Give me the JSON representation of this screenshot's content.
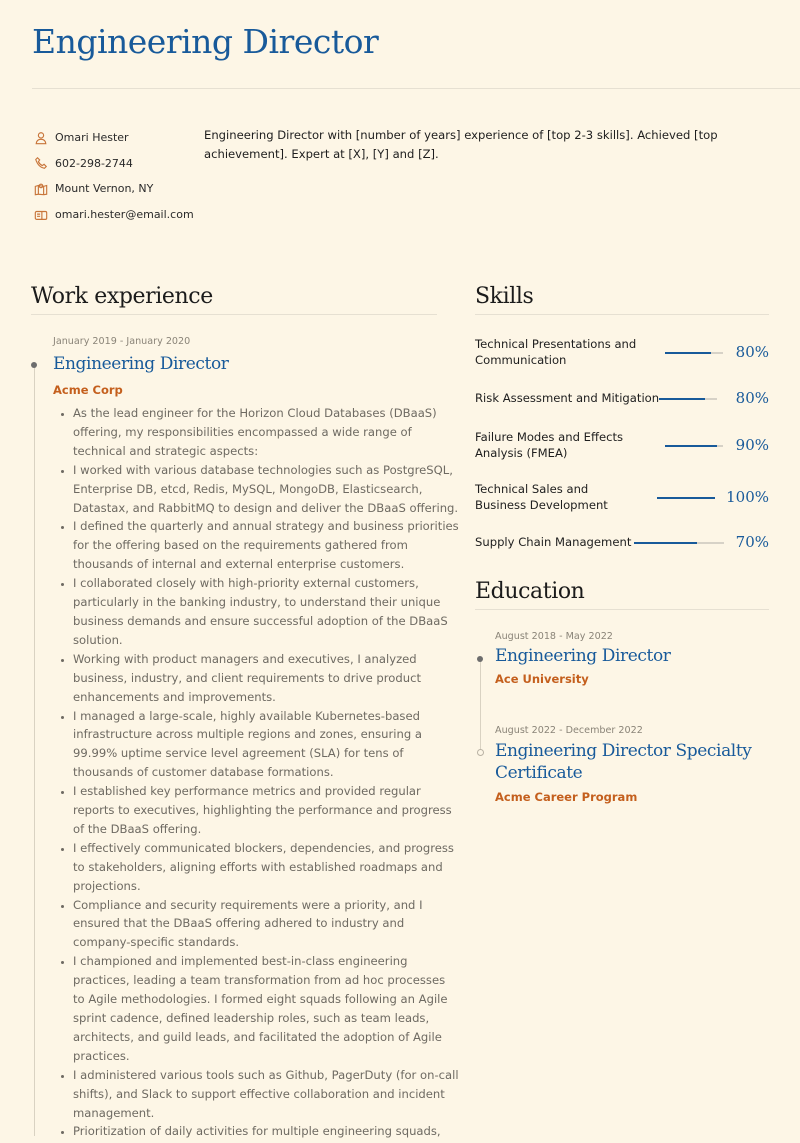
{
  "header": {
    "title": "Engineering Director"
  },
  "contact": {
    "items": [
      {
        "icon": "person-icon",
        "text": "Omari Hester"
      },
      {
        "icon": "phone-icon",
        "text": "602-298-2744"
      },
      {
        "icon": "map-icon",
        "text": "Mount Vernon, NY"
      },
      {
        "icon": "mail-icon",
        "text": "omari.hester@email.com"
      }
    ]
  },
  "summary": "Engineering Director with [number of years] experience of [top 2-3 skills]. Achieved [top achievement]. Expert at [X], [Y] and [Z].",
  "work": {
    "heading": "Work experience",
    "jobs": [
      {
        "date": "January 2019 - January 2020",
        "role": "Engineering Director",
        "company": "Acme Corp",
        "bullets": [
          "As the lead engineer for the Horizon Cloud Databases (DBaaS) offering, my responsibilities encompassed a wide range of technical and strategic aspects:",
          "I worked with various database technologies such as PostgreSQL, Enterprise DB, etcd, Redis, MySQL, MongoDB, Elasticsearch, Datastax, and RabbitMQ to design and deliver the DBaaS offering.",
          "I defined the quarterly and annual strategy and business priorities for the offering based on the requirements gathered from thousands of internal and external enterprise customers.",
          "I collaborated closely with high-priority external customers, particularly in the banking industry, to understand their unique business demands and ensure successful adoption of the DBaaS solution.",
          "Working with product managers and executives, I analyzed business, industry, and client requirements to drive product enhancements and improvements.",
          "I managed a large-scale, highly available Kubernetes-based infrastructure across multiple regions and zones, ensuring a 99.99% uptime service level agreement (SLA) for tens of thousands of customer database formations.",
          "I established key performance metrics and provided regular reports to executives, highlighting the performance and progress of the DBaaS offering.",
          "I effectively communicated blockers, dependencies, and progress to stakeholders, aligning efforts with established roadmaps and projections.",
          "Compliance and security requirements were a priority, and I ensured that the DBaaS offering adhered to industry and company-specific standards.",
          "I championed and implemented best-in-class engineering practices, leading a team transformation from ad hoc processes to Agile methodologies. I formed eight squads following an Agile sprint cadence, defined leadership roles, such as team leads, architects, and guild leads, and facilitated the adoption of Agile practices.",
          "I administered various tools such as Github, PagerDuty (for on-call shifts), and Slack to support effective collaboration and incident management.",
          "Prioritization of daily activities for multiple engineering squads,"
        ]
      }
    ]
  },
  "skills": {
    "heading": "Skills",
    "items": [
      {
        "name": "Technical Presentations and Communication",
        "level": 80,
        "label": "80%"
      },
      {
        "name": "Risk Assessment and Mitigation",
        "level": 80,
        "label": "80%"
      },
      {
        "name": "Failure Modes and Effects Analysis (FMEA)",
        "level": 90,
        "label": "90%"
      },
      {
        "name": "Technical Sales and Business Development",
        "level": 100,
        "label": "100%"
      },
      {
        "name": "Supply Chain Management",
        "level": 70,
        "label": "70%"
      }
    ]
  },
  "education": {
    "heading": "Education",
    "items": [
      {
        "date": "August 2018 - May 2022",
        "degree": "Engineering Director",
        "school": "Ace University"
      },
      {
        "date": "August 2022 - December 2022",
        "degree": "Engineering Director Specialty Certificate",
        "school": "Acme Career Program"
      }
    ]
  },
  "colors": {
    "accent": "#185a9a",
    "org": "#c45f1d",
    "icon": "#c8753a",
    "background": "#fdf6e6"
  }
}
